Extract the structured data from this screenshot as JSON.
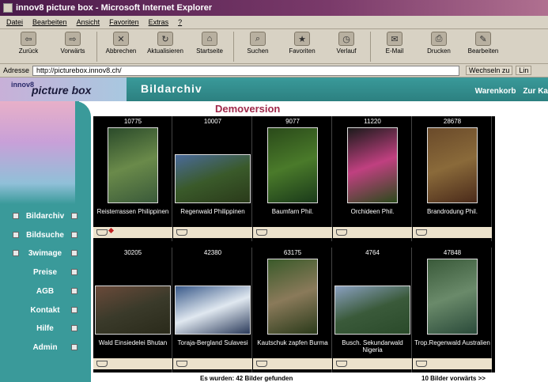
{
  "window": {
    "title": "innov8 picture box - Microsoft Internet Explorer"
  },
  "menu": [
    "Datei",
    "Bearbeiten",
    "Ansicht",
    "Favoriten",
    "Extras",
    "?"
  ],
  "toolbar": [
    {
      "label": "Zurück",
      "icon": "back-arrow-icon",
      "glyph": "⇦"
    },
    {
      "label": "Vorwärts",
      "icon": "forward-arrow-icon",
      "glyph": "⇨"
    },
    {
      "label": "Abbrechen",
      "icon": "stop-icon",
      "glyph": "✕"
    },
    {
      "label": "Aktualisieren",
      "icon": "refresh-icon",
      "glyph": "↻"
    },
    {
      "label": "Startseite",
      "icon": "home-icon",
      "glyph": "⌂"
    },
    {
      "label": "Suchen",
      "icon": "search-icon",
      "glyph": "⌕"
    },
    {
      "label": "Favoriten",
      "icon": "favorites-icon",
      "glyph": "★"
    },
    {
      "label": "Verlauf",
      "icon": "history-icon",
      "glyph": "◷"
    },
    {
      "label": "E-Mail",
      "icon": "mail-icon",
      "glyph": "✉"
    },
    {
      "label": "Drucken",
      "icon": "print-icon",
      "glyph": "⎙"
    },
    {
      "label": "Bearbeiten",
      "icon": "edit-icon",
      "glyph": "✎"
    }
  ],
  "address": {
    "label": "Adresse",
    "url": "http://picturebox.innov8.ch/",
    "go": "Wechseln zu",
    "links": "Lin"
  },
  "site": {
    "logo_small": "innov8",
    "logo_main": "picture box",
    "section_title": "Bildarchiv",
    "header_links": [
      "Warenkorb",
      "Zur Ka"
    ],
    "demo_label": "Demoversion",
    "nav": [
      "Bildarchiv",
      "Bildsuche",
      "3wimage",
      "Preise",
      "AGB",
      "Kontakt",
      "Hilfe",
      "Admin"
    ],
    "images": [
      {
        "id": "10775",
        "caption": "Reisterrassen Philippinen",
        "colors": [
          "#2a4a2a",
          "#6a8a4a",
          "#3a5a3a"
        ]
      },
      {
        "id": "10007",
        "caption": "Regenwald Philippinen",
        "colors": [
          "#4a6a9a",
          "#3a5a2a",
          "#2a3a1a"
        ]
      },
      {
        "id": "9077",
        "caption": "Baumfarn Phil.",
        "colors": [
          "#2a4a1a",
          "#4a7a2a",
          "#1a3a1a"
        ]
      },
      {
        "id": "11220",
        "caption": "Orchideen Phil.",
        "colors": [
          "#1a1a1a",
          "#c04080",
          "#2a4a1a"
        ]
      },
      {
        "id": "28678",
        "caption": "Brandrodung Phil.",
        "colors": [
          "#6a4a2a",
          "#8a6a3a",
          "#4a2a1a"
        ]
      },
      {
        "id": "30205",
        "caption": "Wald Einsiedelei Bhutan",
        "colors": [
          "#6a4a3a",
          "#3a3a2a",
          "#2a2a1a"
        ]
      },
      {
        "id": "42380",
        "caption": "Toraja-Bergland Sulavesi",
        "colors": [
          "#3a5a8a",
          "#e0e8f0",
          "#2a3a5a"
        ]
      },
      {
        "id": "63175",
        "caption": "Kautschuk zapfen Burma",
        "colors": [
          "#3a5a2a",
          "#8a7a5a",
          "#2a3a1a"
        ]
      },
      {
        "id": "4764",
        "caption": "Busch. Sekundarwald Nigeria",
        "colors": [
          "#8aa0c0",
          "#3a5a3a",
          "#2a4a2a"
        ]
      },
      {
        "id": "47848",
        "caption": "Trop.Regenwald Australien",
        "colors": [
          "#3a5a3a",
          "#6a8a6a",
          "#2a4a3a"
        ]
      }
    ],
    "result_text": "Es wurden: 42 Bilder gefunden",
    "next_text": "10 Bilder vorwärts >>"
  }
}
